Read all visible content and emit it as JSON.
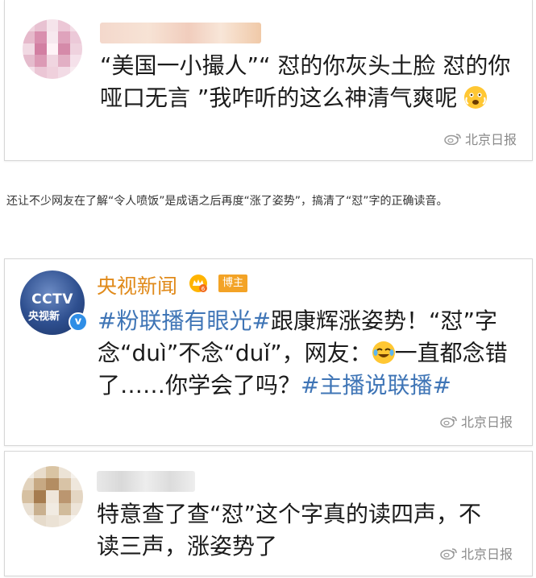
{
  "post1": {
    "avatar_icon": "user-avatar-blurred",
    "text": "“美国一小撮人”“ 怼的你灰头土脸 怼的你哑口无言 ”我咋听的这么神清气爽呢",
    "emoji": "scared-face-emoji",
    "watermark": "北京日报"
  },
  "intro_text": "还让不少网友在了解“令人喷饭”是成语之后再度“涨了姿势”，搞清了“怼”字的正确读音。",
  "post2": {
    "avatar_logo": "CCTV",
    "avatar_sub": "央视新",
    "username": "央视新闻",
    "badge": "博主",
    "hashtag_1": "#粉联播有眼光#",
    "text_a": "跟康辉涨姿势！“怼”字念“duì”不念“duǐ”，网友：",
    "emoji": "crying-laughing-emoji",
    "text_b": "一直都念错了……你学会了吗？",
    "hashtag_2": "#主播说联播#",
    "watermark": "北京日报"
  },
  "post3": {
    "avatar_icon": "user-avatar-blurred",
    "text": "特意查了查“怼”这个字真的读四声，不读三声，涨姿势了",
    "watermark": "北京日报"
  },
  "colors": {
    "hashtag": "#3f75b6",
    "username": "#e08a1a",
    "badge": "#f3a326"
  }
}
